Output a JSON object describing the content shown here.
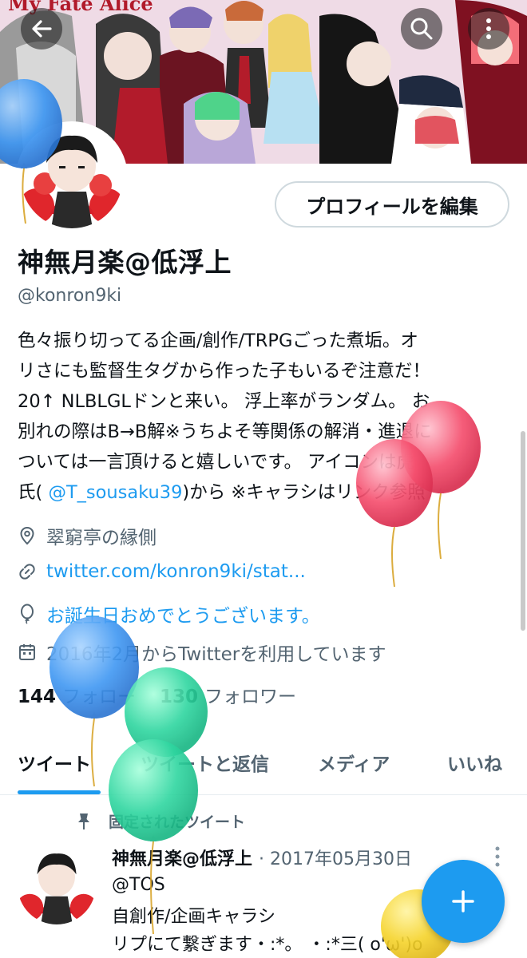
{
  "banner": {
    "title": "My Fate Alice"
  },
  "header_buttons": {
    "back_icon": "arrow-left-icon",
    "search_icon": "search-icon",
    "more_icon": "more-vertical-icon"
  },
  "profile": {
    "edit_button": "プロフィールを編集",
    "name": "神無月楽@低浮上",
    "handle": "@konron9ki",
    "bio_lines": [
      "色々振り切ってる企画/創作/TRPGごった煮垢。オ",
      "リさにも監督生タグから作った子もいるぞ注意だ！",
      "20↑ NLBLGLドンと来い。 浮上率がランダム。 お",
      "別れの際はB→B解※うちよそ等関係の解消・進退に",
      "ついては一言頂けると嬉しいです。 アイコンは虎"
    ],
    "bio_last_prefix": "氏( ",
    "bio_mention": "@T_sousaku39",
    "bio_last_suffix": ")から ※キャラシはリンク参照",
    "location": "翠窮亭の縁側",
    "url": "twitter.com/konron9ki/stat...",
    "birthday": "お誕生日おめでとうございます。",
    "joined": "2016年2月からTwitterを利用しています",
    "following_count": "144",
    "following_label": "フォロー",
    "followers_count": "130",
    "followers_label": "フォロワー"
  },
  "tabs": [
    {
      "label": "ツイート"
    },
    {
      "label": "ツイートと返信"
    },
    {
      "label": "メディア"
    },
    {
      "label": "いいね"
    }
  ],
  "pinned_tweet": {
    "label": "固定されたツイート",
    "author": "神無月楽@低浮上",
    "date": "· 2017年05月30日",
    "lines": [
      "@TOS",
      "自創作/企画キャラシ",
      "リプにて繋ぎます・:*。 ・:*三( o'ω')o"
    ]
  },
  "colors": {
    "accent": "#1d9bf0",
    "secondary_text": "#536471",
    "primary_text": "#0f1419"
  }
}
